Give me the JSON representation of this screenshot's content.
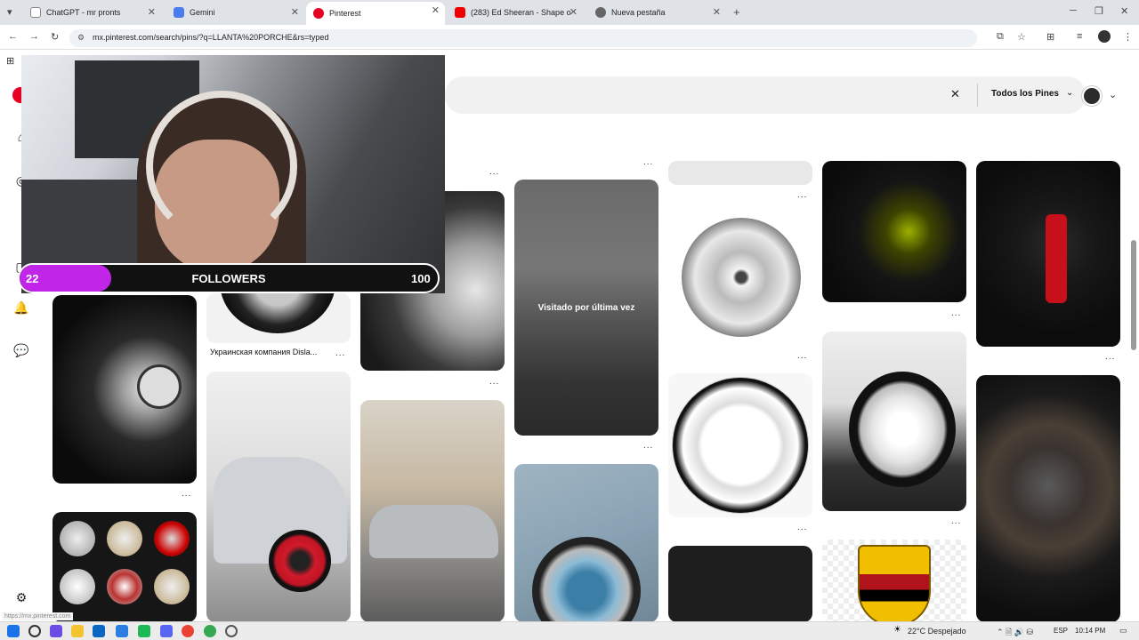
{
  "browser": {
    "tabs": [
      {
        "label": "ChatGPT - mr pronts"
      },
      {
        "label": "Gemini"
      },
      {
        "label": "Pinterest"
      },
      {
        "label": "(283) Ed Sheeran - Shape o"
      },
      {
        "label": "Nueva pestaña"
      }
    ],
    "url": "mx.pinterest.com/search/pins/?q=LLANTA%20PORCHE&rs=typed"
  },
  "pinterest": {
    "filter_label": "Todos los Pines",
    "pins": {
      "visited_overlay": "Visitado por última vez",
      "ukr_caption": "Украинская компания Disla...",
      "dots": "..."
    },
    "status_url": "https://mx.pinterest.com"
  },
  "stream": {
    "followers_current": "22",
    "followers_label": "FOLLOWERS",
    "followers_goal": "100",
    "progress_fraction": 0.22
  },
  "taskbar": {
    "weather": "22°C  Despejado",
    "lang": "ESP",
    "time": "10:14 PM"
  },
  "colors": {
    "accent": "#e60023",
    "progress": "#c126e8"
  }
}
